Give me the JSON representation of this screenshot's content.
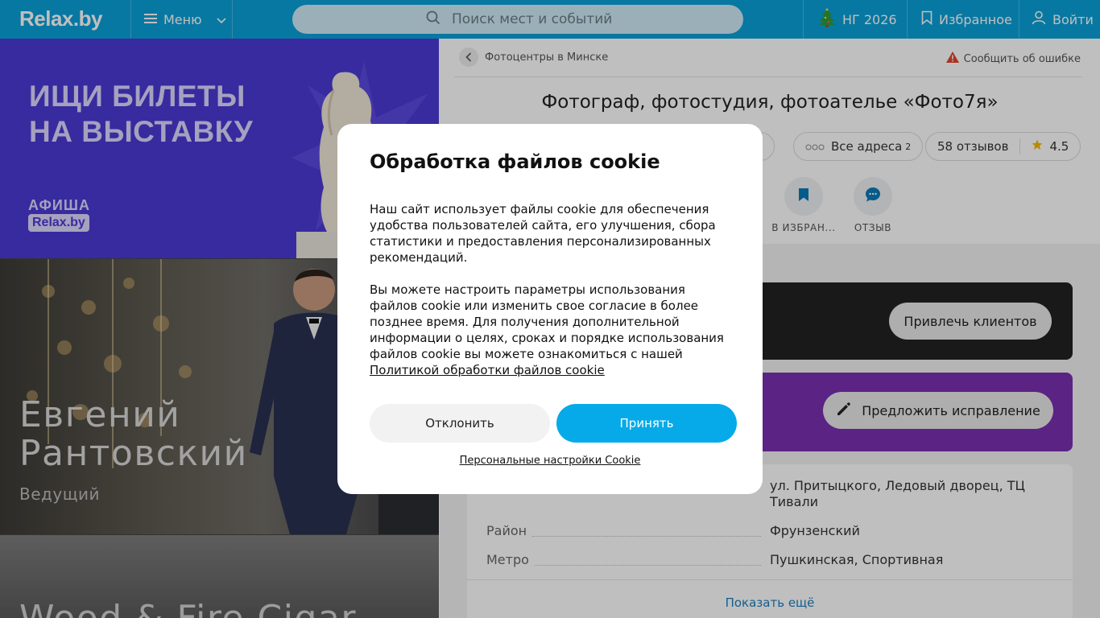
{
  "header": {
    "logo": "Relax.by",
    "menu_label": "Меню",
    "search_placeholder": "Поиск мест и событий",
    "ng_label": "НГ 2026",
    "favorites_label": "Избранное",
    "login_label": "Войти",
    "icons": [
      "hamburger-icon",
      "chevron-down-icon",
      "search-icon",
      "tree-icon",
      "bookmark-icon",
      "user-icon"
    ]
  },
  "left_promos": {
    "banner1": {
      "title_line1": "ИЩИ БИЛЕТЫ",
      "title_line2": "НА ВЫСТАВКУ",
      "afisha": "АФИША",
      "afisha_logo": "Relax.by"
    },
    "banner2": {
      "name_line1": "Евгений",
      "name_line2": "Рантовский",
      "role": "Ведущий"
    },
    "banner3": {
      "name": "Wood & Fire Cigar"
    }
  },
  "content": {
    "breadcrumb": "Фотоцентры в Минске",
    "report_error": "Сообщить об ошибке",
    "title": "Фотограф, фотостудия, фотоателье «Фото7я»",
    "chips": {
      "phone_fragment": "00",
      "all_addresses": "Все адреса",
      "addresses_count": "2",
      "reviews": "58 отзывов",
      "rating": "4.5"
    },
    "actions": {
      "favorite": "В ИЗБРАН...",
      "review": "ОТЗЫВ"
    },
    "attract_button": "Привлечь клиентов",
    "suggest_button": "Предложить исправление",
    "info": {
      "address": "ул. Притыцкого, Ледовый дворец, ТЦ Тивали",
      "district_label": "Район",
      "district": "Фрунзенский",
      "metro_label": "Метро",
      "metro": "Пушкинская, Спортивная",
      "show_more": "Показать ещё"
    },
    "accent_colors": {
      "header": "#0aa0d8",
      "promo": "#4a3ad4",
      "purple_card": "#7a2fb0",
      "accept": "#07aae8"
    }
  },
  "cookie_modal": {
    "title": "Обработка файлов cookie",
    "paragraph1": "Наш сайт использует файлы cookie для обеспечения удобства пользователей сайта, его улучшения, сбора статистики и предоставления персонализированных рекомендаций.",
    "paragraph2": "Вы можете настроить параметры использования файлов cookie или изменить свое согласие в более позднее время. Для получения дополнительной информации о целях, сроках и порядке использования файлов cookie вы можете ознакомиться с нашей",
    "policy_link": "Политикой обработки файлов cookie",
    "decline": "Отклонить",
    "accept": "Принять",
    "settings_link": "Персональные настройки Cookie"
  }
}
